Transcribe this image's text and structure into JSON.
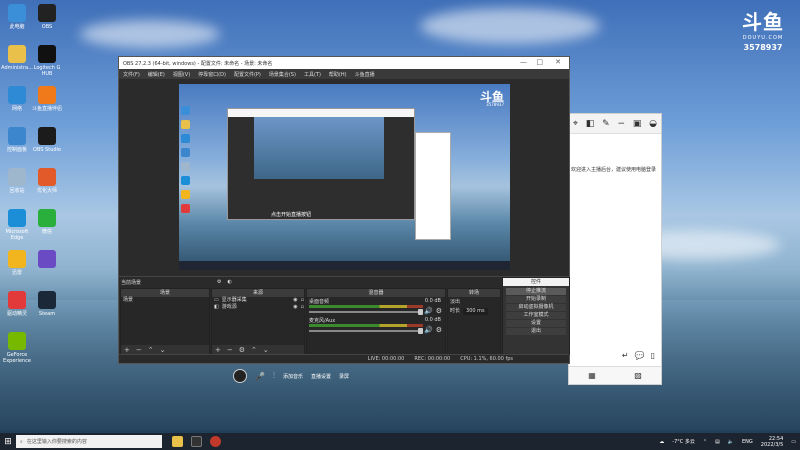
{
  "desktop_icons": [
    {
      "label": "此电脑",
      "icon": "computer-icon",
      "color": "#3a8fd8"
    },
    {
      "label": "OBS",
      "icon": "obs-icon",
      "color": "#222222"
    },
    {
      "label": "Administra...",
      "icon": "folder-icon",
      "color": "#e8c04a"
    },
    {
      "label": "Logitech G HUB",
      "icon": "logitech-icon",
      "color": "#111111"
    },
    {
      "label": "网络",
      "icon": "network-icon",
      "color": "#2f8ad6"
    },
    {
      "label": "斗鱼直播伴侣",
      "icon": "douyu-icon",
      "color": "#f07a1a"
    },
    {
      "label": "控制面板",
      "icon": "control-panel-icon",
      "color": "#3b86cc"
    },
    {
      "label": "OBS Studio",
      "icon": "obs-studio-icon",
      "color": "#1b1b1b"
    },
    {
      "label": "回收站",
      "icon": "recycle-bin-icon",
      "color": "#9fb7cc"
    },
    {
      "label": "优化大师",
      "icon": "app-icon",
      "color": "#e35a2a"
    },
    {
      "label": "Microsoft Edge",
      "icon": "edge-icon",
      "color": "#1c8ed8"
    },
    {
      "label": "微信",
      "icon": "wechat-icon",
      "color": "#2aae3c"
    },
    {
      "label": "迅雷",
      "icon": "thunder-icon",
      "color": "#f2b51e"
    },
    {
      "label": "",
      "icon": "app-icon",
      "color": "#6a4bc4"
    },
    {
      "label": "驱动精灵",
      "icon": "app-icon",
      "color": "#e23a3a"
    },
    {
      "label": "Steam",
      "icon": "steam-icon",
      "color": "#1b2838"
    },
    {
      "label": "GeForce Experience",
      "icon": "nvidia-icon",
      "color": "#76b900"
    }
  ],
  "watermark": {
    "logo": "斗鱼",
    "sub": "DOUYU.COM",
    "room": "3578937"
  },
  "obs": {
    "title": "OBS 27.2.3 (64-bit, windows) - 配置文件: 未命名 - 场景: 未命名",
    "menu": [
      "文件(F)",
      "编辑(E)",
      "视图(V)",
      "停靠窗口(D)",
      "配置文件(P)",
      "场景集合(S)",
      "工具(T)",
      "帮助(H)",
      "斗鱼直播"
    ],
    "preview_label": "当前场景",
    "preview_msg": "点击开始直播按钮",
    "scenes_title": "场景",
    "scenes": [
      "场景"
    ],
    "sources_title": "来源",
    "sources": [
      "显示器采集",
      "游戏源"
    ],
    "mixer_title": "混音器",
    "mixer": [
      {
        "name": "桌面音频",
        "db": "0.0 dB"
      },
      {
        "name": "麦克风/Aux",
        "db": "0.0 dB"
      }
    ],
    "transitions_title": "转场",
    "transition_label": "淡出",
    "duration_label": "时长",
    "duration_value": "300 ms",
    "controls_title": "控件",
    "controls": [
      "停止推流",
      "开始录制",
      "启动虚拟摄像机",
      "工作室模式",
      "设置",
      "退出"
    ],
    "status": {
      "live": "LIVE: 00:00:00",
      "rec": "REC: 00:00:00",
      "cpu": "CPU: 1.1%, 60.00 fps"
    }
  },
  "float_bar": {
    "items": [
      "添加音乐",
      "直播设置",
      "录屏"
    ]
  },
  "bgwin": {
    "text": "欢迎进入主播后台，建议使用电脑登录"
  },
  "taskbar": {
    "search_placeholder": "在这里输入你要搜索的内容",
    "weather": "-7°C 多云",
    "lang": "ENG",
    "time": "22:54",
    "date": "2022/3/5"
  }
}
